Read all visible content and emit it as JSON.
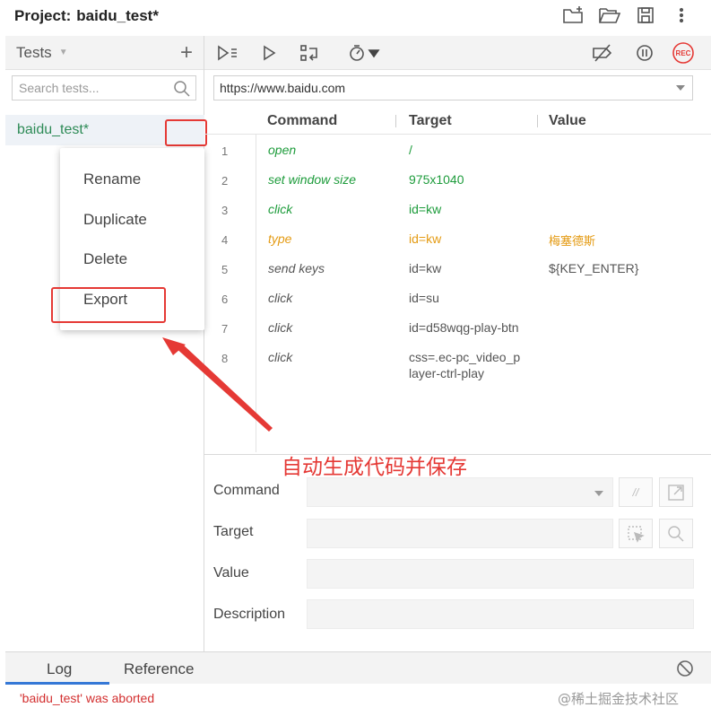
{
  "header": {
    "project_label": "Project:",
    "project_name": "baidu_test*",
    "icons": [
      "new-folder-icon",
      "open-folder-icon",
      "save-icon",
      "more-vertical-icon"
    ]
  },
  "tests_panel": {
    "title": "Tests",
    "add_symbol": "+",
    "search_placeholder": "Search tests...",
    "selected_test": "baidu_test*"
  },
  "context_menu": {
    "items": [
      "Rename",
      "Duplicate",
      "Delete",
      "Export"
    ]
  },
  "toolbar": {
    "icons": [
      "run-all-icon",
      "run-icon",
      "step-icon",
      "speed-icon",
      "disable-breakpoints-icon",
      "pause-icon",
      "record-icon"
    ],
    "rec_label": "REC"
  },
  "url": "https://www.baidu.com",
  "grid": {
    "headers": [
      "Command",
      "Target",
      "Value"
    ],
    "rows": [
      {
        "num": "1",
        "command": "open",
        "target": "/",
        "value": "",
        "color": "green"
      },
      {
        "num": "2",
        "command": "set window size",
        "target": "975x1040",
        "value": "",
        "color": "green"
      },
      {
        "num": "3",
        "command": "click",
        "target": "id=kw",
        "value": "",
        "color": "green"
      },
      {
        "num": "4",
        "command": "type",
        "target": "id=kw",
        "value": "梅塞德斯",
        "color": "orange"
      },
      {
        "num": "5",
        "command": "send keys",
        "target": "id=kw",
        "value": "${KEY_ENTER}",
        "color": "gray"
      },
      {
        "num": "6",
        "command": "click",
        "target": "id=su",
        "value": "",
        "color": "gray"
      },
      {
        "num": "7",
        "command": "click",
        "target": "id=d58wqg-play-btn",
        "value": "",
        "color": "gray"
      },
      {
        "num": "8",
        "command": "click",
        "target_line1": "css=.ec-pc_video_p",
        "target_line2": "layer-ctrl-play",
        "value": "",
        "color": "gray"
      }
    ]
  },
  "annotation": "自动生成代码并保存",
  "form": {
    "command_label": "Command",
    "target_label": "Target",
    "value_label": "Value",
    "description_label": "Description",
    "comment_symbol": "//"
  },
  "bottom": {
    "tabs": [
      "Log",
      "Reference"
    ],
    "log_message": "'baidu_test' was aborted",
    "watermark": "@稀土掘金技术社区"
  },
  "colors": {
    "green": "#1e9c3c",
    "orange": "#e49b14",
    "annotation_red": "#e53935",
    "tab_underline": "#3578d6"
  }
}
